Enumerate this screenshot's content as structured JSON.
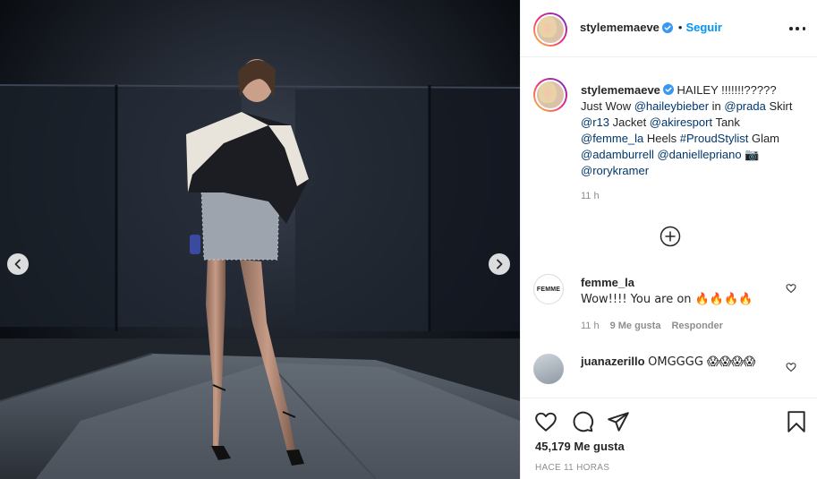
{
  "post": {
    "author": "stylememaeve",
    "follow_label": "Seguir",
    "dot": "•",
    "caption": {
      "parts": [
        {
          "t": "text",
          "v": "HAILEY !!!!!!!????? Just Wow "
        },
        {
          "t": "mention",
          "v": "@haileybieber"
        },
        {
          "t": "text",
          "v": " in "
        },
        {
          "t": "mention",
          "v": "@prada"
        },
        {
          "t": "text",
          "v": " Skirt "
        },
        {
          "t": "mention",
          "v": "@r13"
        },
        {
          "t": "text",
          "v": " Jacket "
        },
        {
          "t": "mention",
          "v": "@akiresport"
        },
        {
          "t": "text",
          "v": " Tank "
        },
        {
          "t": "mention",
          "v": "@femme_la"
        },
        {
          "t": "text",
          "v": " Heels "
        },
        {
          "t": "hashtag",
          "v": "#ProudStylist"
        },
        {
          "t": "text",
          "v": " Glam "
        },
        {
          "t": "mention",
          "v": "@adamburrell"
        },
        {
          "t": "text",
          "v": " "
        },
        {
          "t": "mention",
          "v": "@daniellepriano"
        },
        {
          "t": "text",
          "v": " 📷 "
        },
        {
          "t": "mention",
          "v": "@rorykramer"
        }
      ],
      "time": "11 h"
    },
    "comments": [
      {
        "user": "femme_la",
        "avatar_text": "FEMME",
        "text": "Wow!!!! You are on 🔥🔥🔥🔥",
        "time": "11 h",
        "likes": "9 Me gusta",
        "reply": "Responder"
      },
      {
        "user": "juanazerillo",
        "text": "OMGGGG 😱😱😱😱"
      }
    ],
    "likes": "45,179 Me gusta",
    "posted": "HACE 11 HORAS"
  },
  "icons": {
    "verified": "verified-badge-icon",
    "more": "more-options-icon",
    "load_more": "plus-circle-icon",
    "heart": "heart-icon",
    "comment": "comment-icon",
    "share": "share-icon",
    "save": "bookmark-icon",
    "prev": "chevron-left-icon",
    "next": "chevron-right-icon"
  },
  "colors": {
    "link": "#0095f6",
    "mention": "#00376b",
    "text": "#262626",
    "muted": "#8e8e8e",
    "verified": "#3897f0"
  }
}
